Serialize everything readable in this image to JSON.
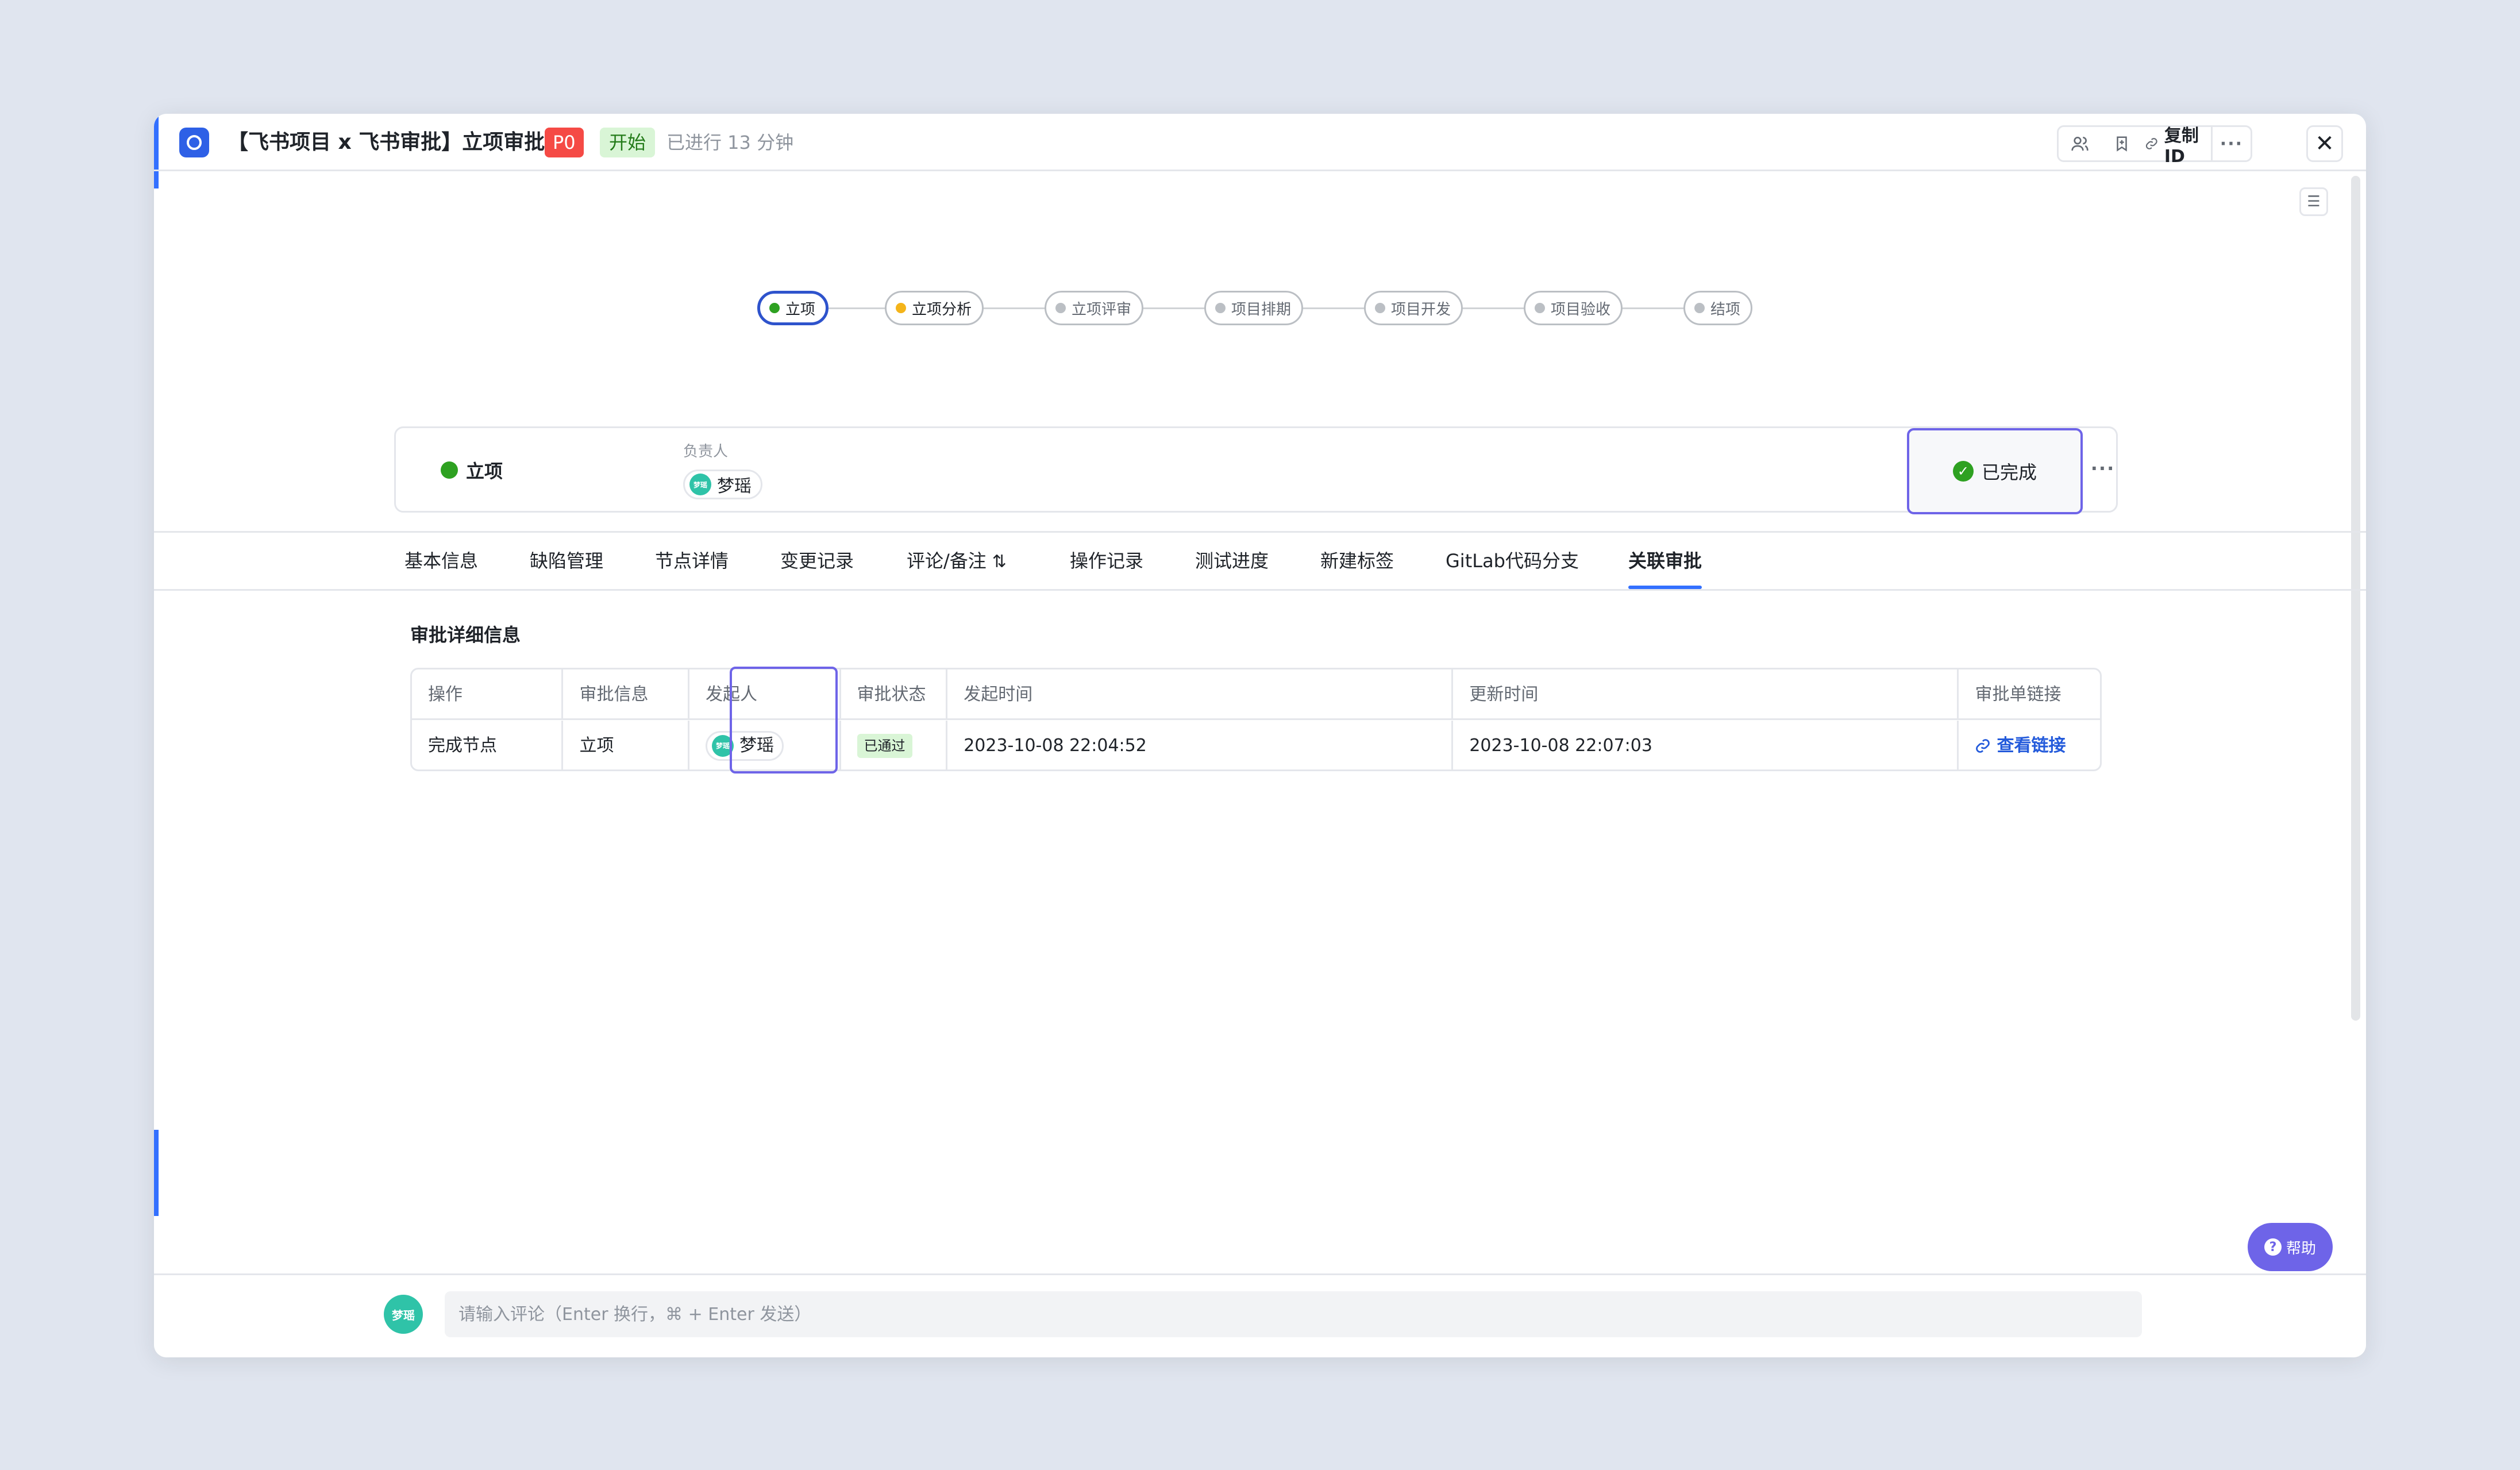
{
  "header": {
    "title": "【飞书项目 x 飞书审批】立项审批",
    "priority_tag": "P0",
    "status_tag": "开始",
    "elapsed": "已进行 13 分钟",
    "copy_id_label": "复制ID",
    "more_label": "···",
    "close_label": "✕"
  },
  "flow": {
    "nodes": [
      {
        "label": "立项",
        "state": "done"
      },
      {
        "label": "立项分析",
        "state": "in-progress"
      },
      {
        "label": "立项评审",
        "state": "pending"
      },
      {
        "label": "项目排期",
        "state": "pending"
      },
      {
        "label": "项目开发",
        "state": "pending"
      },
      {
        "label": "项目验收",
        "state": "pending"
      },
      {
        "label": "结项",
        "state": "pending"
      }
    ]
  },
  "node_card": {
    "node_name": "立项",
    "owner_label": "负责人",
    "owner_name": "梦瑶",
    "owner_avatar_text": "梦瑶",
    "done_label": "已完成",
    "more_label": "···"
  },
  "tabs": [
    {
      "label": "基本信息",
      "active": false
    },
    {
      "label": "缺陷管理",
      "active": false
    },
    {
      "label": "节点详情",
      "active": false
    },
    {
      "label": "变更记录",
      "active": false
    },
    {
      "label": "评论/备注",
      "active": false
    },
    {
      "label": "操作记录",
      "active": false
    },
    {
      "label": "测试进度",
      "active": false
    },
    {
      "label": "新建标签",
      "active": false
    },
    {
      "label": "GitLab代码分支",
      "active": false
    },
    {
      "label": "关联审批",
      "active": true
    }
  ],
  "approval": {
    "section_title": "审批详细信息",
    "columns": [
      "操作",
      "审批信息",
      "发起人",
      "审批状态",
      "发起时间",
      "更新时间",
      "审批单链接"
    ],
    "rows": [
      {
        "action": "完成节点",
        "info": "立项",
        "initiator": "梦瑶",
        "initiator_avatar_text": "梦瑶",
        "status": "已通过",
        "started_at": "2023-10-08 22:04:52",
        "updated_at": "2023-10-08 22:07:03",
        "link_label": "查看链接"
      }
    ]
  },
  "help": {
    "label": "帮助"
  },
  "comment": {
    "avatar_text": "梦瑶",
    "placeholder": "请输入评论（Enter 换行，⌘ + Enter 发送）"
  },
  "colors": {
    "accent": "#3370FF",
    "highlight": "#6E64E8",
    "success": "#2EA121",
    "danger": "#F54A45",
    "warning": "#F4B41A",
    "avatar": "#2FC3A8"
  },
  "icons": [
    "project-icon",
    "members-icon",
    "bookmark-icon",
    "link-icon",
    "more-icon",
    "close-icon",
    "panel-settings-icon",
    "sort-icon",
    "check-circle-icon",
    "help-icon"
  ]
}
